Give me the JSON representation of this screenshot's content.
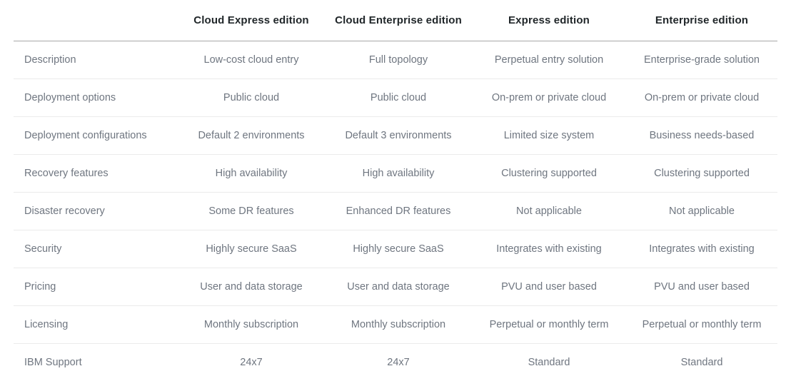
{
  "table": {
    "feature_column_header": "",
    "columns": [
      "Cloud Express edition",
      "Cloud Enterprise edition",
      "Express edition",
      "Enterprise edition"
    ],
    "rows": [
      {
        "feature": "Description",
        "values": [
          "Low-cost cloud entry",
          "Full topology",
          "Perpetual entry solution",
          "Enterprise-grade solution"
        ]
      },
      {
        "feature": "Deployment options",
        "values": [
          "Public cloud",
          "Public cloud",
          "On-prem or private cloud",
          "On-prem or private cloud"
        ]
      },
      {
        "feature": "Deployment configurations",
        "values": [
          "Default 2 environments",
          "Default 3 environments",
          "Limited size system",
          "Business needs-based"
        ]
      },
      {
        "feature": "Recovery features",
        "values": [
          "High availability",
          "High availability",
          "Clustering supported",
          "Clustering supported"
        ]
      },
      {
        "feature": "Disaster recovery",
        "values": [
          "Some DR features",
          "Enhanced DR features",
          "Not applicable",
          "Not applicable"
        ]
      },
      {
        "feature": "Security",
        "values": [
          "Highly secure SaaS",
          "Highly secure SaaS",
          "Integrates with existing",
          "Integrates with existing"
        ]
      },
      {
        "feature": "Pricing",
        "values": [
          "User and data storage",
          "User and data storage",
          "PVU and user based",
          "PVU and user based"
        ]
      },
      {
        "feature": "Licensing",
        "values": [
          "Monthly subscription",
          "Monthly subscription",
          "Perpetual or monthly term",
          "Perpetual or monthly term"
        ]
      },
      {
        "feature": "IBM Support",
        "values": [
          "24x7",
          "24x7",
          "Standard",
          "Standard"
        ]
      }
    ]
  },
  "colors": {
    "header_text": "#21272a",
    "body_text": "#6f7680",
    "header_rule": "#a8a8a8",
    "row_rule": "#ebebeb",
    "background": "#ffffff"
  }
}
